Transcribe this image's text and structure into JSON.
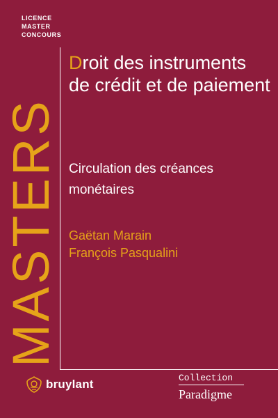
{
  "series": {
    "tags": [
      "LICENCE",
      "MASTER",
      "CONCOURS"
    ],
    "name": "MASTERS"
  },
  "book": {
    "title_first_letter": "D",
    "title_rest": "roit des instruments de crédit et de paiement",
    "subtitle": "Circulation des créances monétaires",
    "authors": [
      "Gaëtan Marain",
      "François Pasqualini"
    ]
  },
  "publisher": {
    "name": "bruylant",
    "logo_icon": "bruylant-emblem-icon"
  },
  "collection": {
    "label": "Collection",
    "name": "Paradigme"
  },
  "colors": {
    "background": "#8e1c3c",
    "accent": "#e6a319",
    "text": "#ffffff"
  }
}
